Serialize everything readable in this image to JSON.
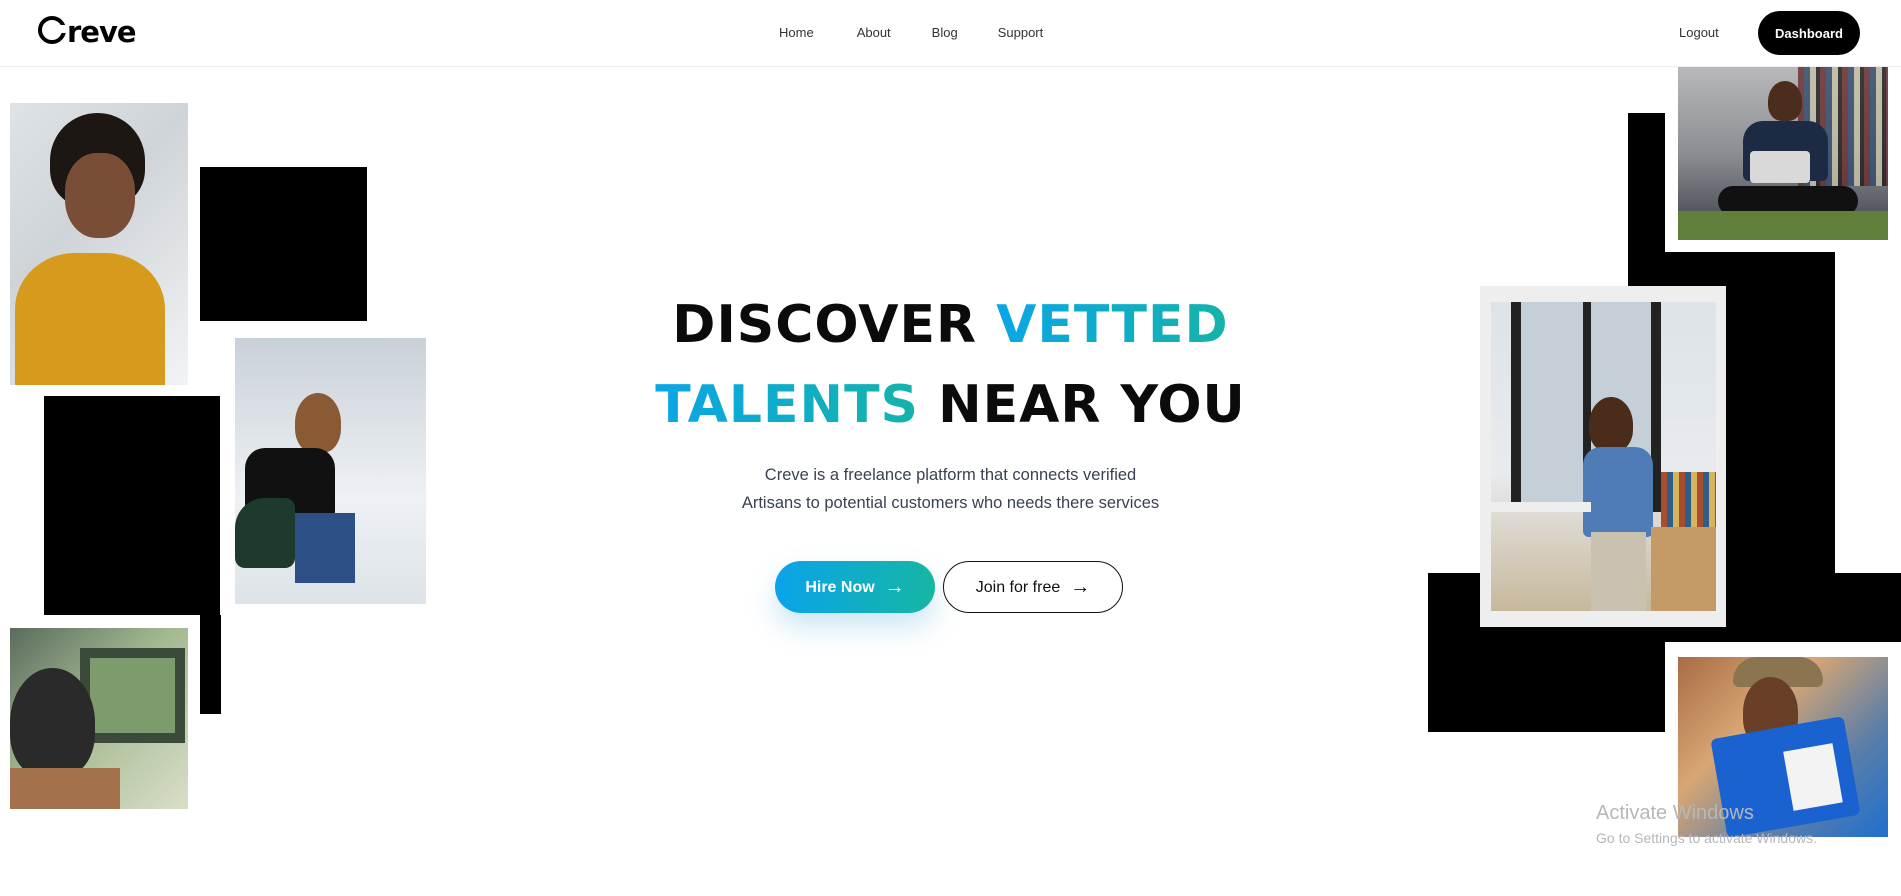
{
  "nav": {
    "logo": "reve",
    "links": [
      "Home",
      "About",
      "Blog",
      "Support"
    ],
    "logout": "Logout",
    "dashboard": "Dashboard"
  },
  "hero": {
    "line1_a": "DISCOVER ",
    "line1_b": "VETTED",
    "line2_a": "TALENTS",
    "line2_b": " NEAR YOU",
    "sub1": "Creve is a freelance platform that connects verified",
    "sub2": "Artisans to potential customers who needs there services",
    "hire_label": "Hire Now",
    "join_label": "Join for free",
    "arrow_glyph": "→"
  },
  "colors": {
    "accent_start": "#0aa6e6",
    "accent_end": "#15b3a9",
    "dark": "#000000"
  },
  "windows_notice": {
    "title": "Activate Windows",
    "hint": "Go to Settings to activate Windows."
  }
}
